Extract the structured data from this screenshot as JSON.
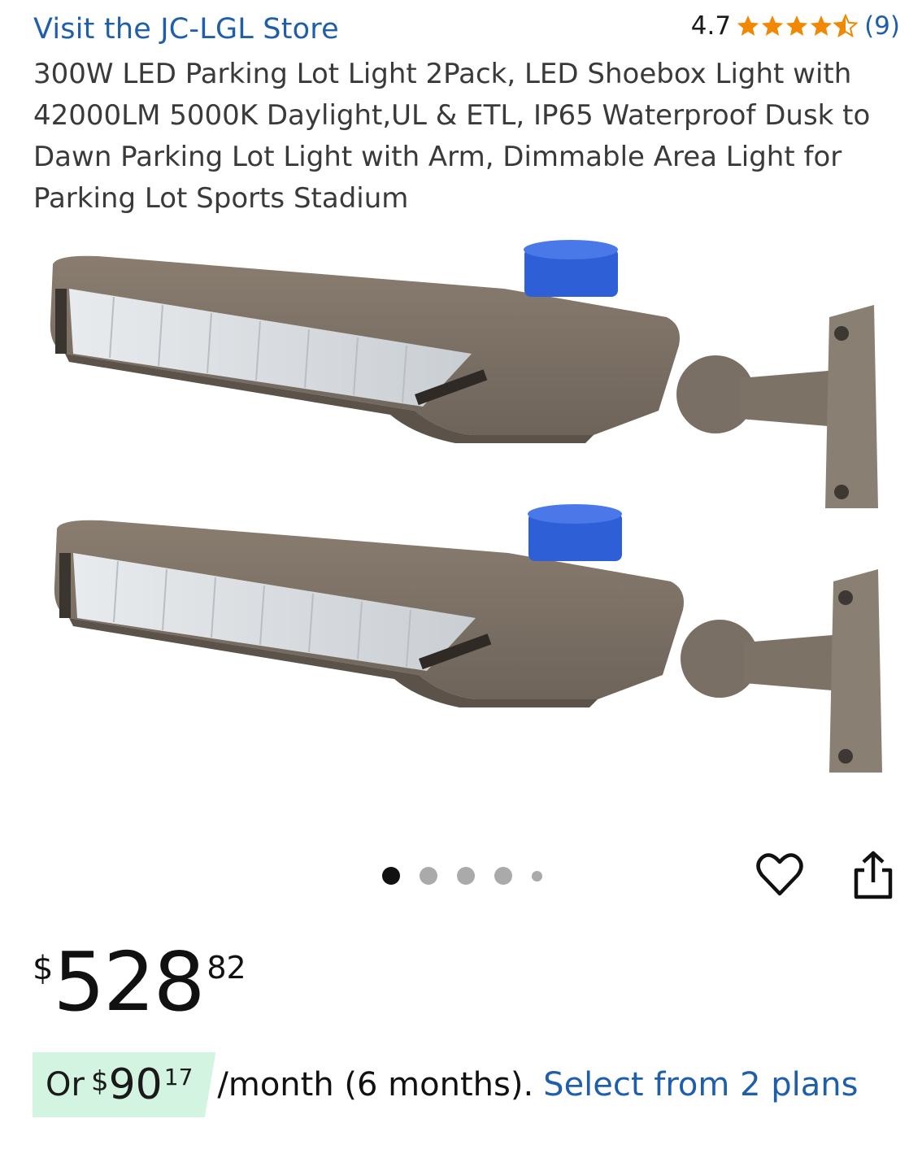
{
  "store": {
    "link_label": "Visit the JC-LGL Store"
  },
  "rating": {
    "value": "4.7",
    "stars": 4.5,
    "count": "(9)"
  },
  "product": {
    "title": "300W LED Parking Lot Light 2Pack, LED Shoebox Light with 42000LM 5000K Daylight,UL & ETL, IP65 Waterproof Dusk to Dawn Parking Lot Light with Arm, Dimmable Area Light for Parking Lot Sports Stadium"
  },
  "carousel": {
    "total": 5,
    "active_index": 0
  },
  "actions": {
    "favorite_icon": "heart-icon",
    "share_icon": "share-icon"
  },
  "price": {
    "currency": "$",
    "whole": "528",
    "cents": "82"
  },
  "financing": {
    "prefix": "Or",
    "currency": "$",
    "whole": "90",
    "cents": "17",
    "suffix": "/month (6 months).",
    "link": "Select from 2 plans"
  },
  "colors": {
    "link": "#1f5ea8",
    "star": "#f08804",
    "highlight": "#d4f4e2"
  }
}
